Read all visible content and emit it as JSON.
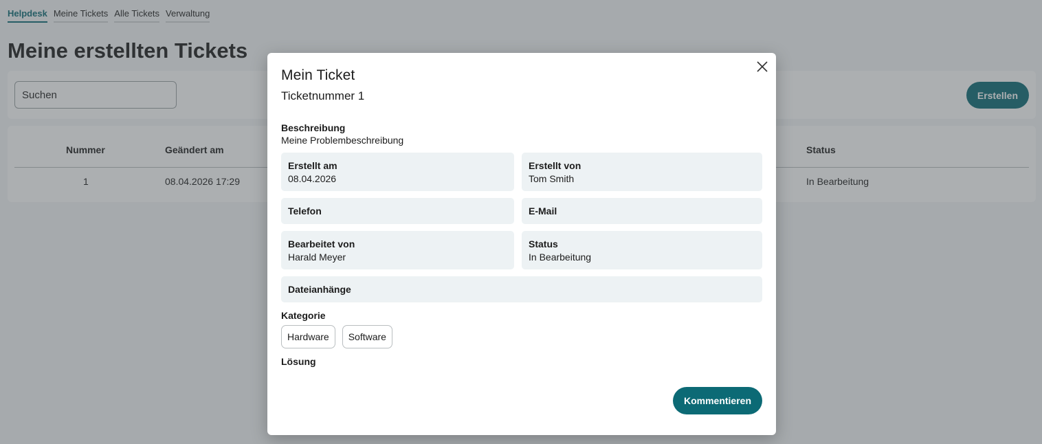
{
  "nav": {
    "items": [
      {
        "label": "Helpdesk",
        "active": true
      },
      {
        "label": "Meine Tickets",
        "active": false
      },
      {
        "label": "Alle Tickets",
        "active": false
      },
      {
        "label": "Verwaltung",
        "active": false
      }
    ]
  },
  "page": {
    "title": "Meine erstellten Tickets",
    "search_placeholder": "Suchen",
    "create_label": "Erstellen"
  },
  "table": {
    "headers": {
      "nummer": "Nummer",
      "geaendert": "Geändert am",
      "status": "Status"
    },
    "rows": [
      {
        "nummer": "1",
        "geaendert": "08.04.2026 17:29",
        "status": "In Bearbeitung"
      }
    ]
  },
  "modal": {
    "title": "Mein Ticket",
    "subtitle": "Ticketnummer 1",
    "beschreibung_label": "Beschreibung",
    "beschreibung_value": "Meine Problembeschreibung",
    "erstellt_am_label": "Erstellt am",
    "erstellt_am_value": "08.04.2026",
    "erstellt_von_label": "Erstellt von",
    "erstellt_von_value": "Tom Smith",
    "telefon_label": "Telefon",
    "email_label": "E-Mail",
    "bearbeitet_von_label": "Bearbeitet von",
    "bearbeitet_von_value": "Harald Meyer",
    "status_label": "Status",
    "status_value": "In Bearbeitung",
    "dateianhaenge_label": "Dateianhänge",
    "kategorie_label": "Kategorie",
    "kategorien": [
      "Hardware",
      "Software"
    ],
    "loesung_label": "Lösung",
    "comment_label": "Kommentieren"
  },
  "colors": {
    "accent": "#0c6a75",
    "field_bg": "#edf2f4",
    "overlay": "rgba(70,78,82,0.45)"
  },
  "icons": {
    "close": "close-icon"
  }
}
